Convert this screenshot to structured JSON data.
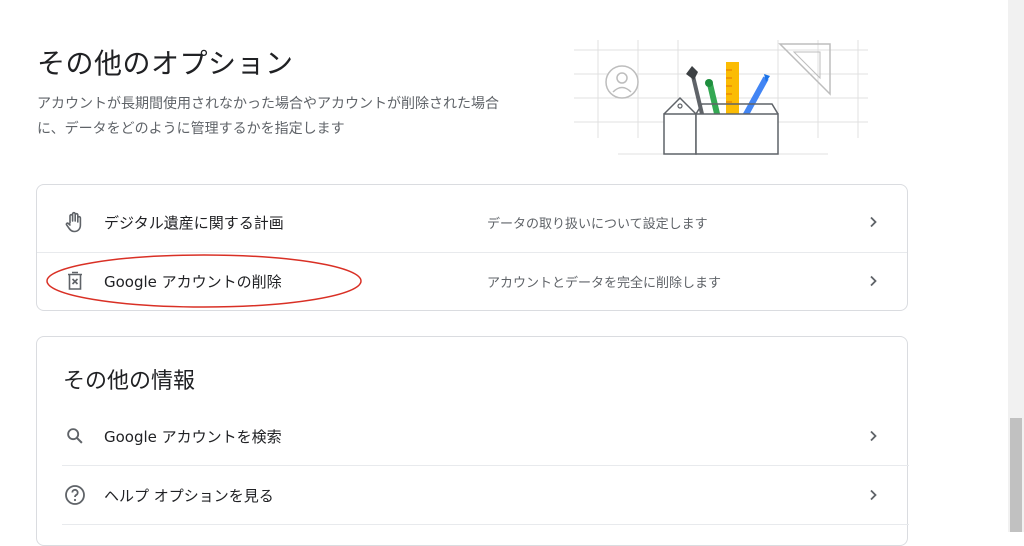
{
  "page": {
    "title": "その他のオプション",
    "description": "アカウントが長期間使用されなかった場合やアカウントが削除された場合に、データをどのように管理するかを指定します"
  },
  "options_card": {
    "rows": [
      {
        "icon": "hand-icon",
        "label": "デジタル遺産に関する計画",
        "detail": "データの取り扱いについて設定します"
      },
      {
        "icon": "delete-account-icon",
        "label": "Google アカウントの削除",
        "detail": "アカウントとデータを完全に削除します"
      }
    ]
  },
  "info_card": {
    "title": "その他の情報",
    "rows": [
      {
        "icon": "search-icon",
        "label": "Google アカウントを検索"
      },
      {
        "icon": "help-circle-icon",
        "label": "ヘルプ オプションを見る"
      }
    ]
  },
  "colors": {
    "highlight": "#d93025",
    "text_primary": "#202124",
    "text_secondary": "#5f6368",
    "border": "#dadce0"
  }
}
